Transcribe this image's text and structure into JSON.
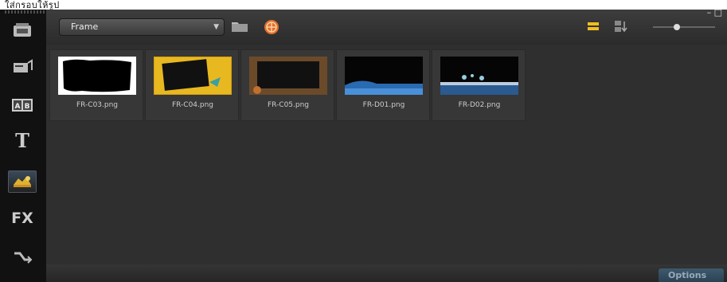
{
  "header": {
    "caption": "ใส่กรอบให้รูป"
  },
  "toolbar": {
    "category": "Frame",
    "dropdown_arrow": "▼",
    "icons": [
      "folder-icon",
      "globe-icon",
      "list-view-icon",
      "sort-icon",
      "zoom-slider"
    ]
  },
  "sidebar": {
    "items": [
      {
        "name": "media-library-icon"
      },
      {
        "name": "instant-project-icon"
      },
      {
        "name": "transition-icon",
        "label": "AB"
      },
      {
        "name": "title-icon",
        "label": "T"
      },
      {
        "name": "graphic-icon",
        "active": true
      },
      {
        "name": "filter-icon",
        "label": "FX"
      },
      {
        "name": "path-icon"
      }
    ]
  },
  "library": {
    "items": [
      {
        "label": "FR-C03.png",
        "thumb": "frame-torn-white"
      },
      {
        "label": "FR-C04.png",
        "thumb": "frame-yellow-tape"
      },
      {
        "label": "FR-C05.png",
        "thumb": "frame-brown-wood"
      },
      {
        "label": "FR-D01.png",
        "thumb": "frame-blue-wave"
      },
      {
        "label": "FR-D02.png",
        "thumb": "frame-blue-splash"
      }
    ]
  },
  "footer": {
    "options_label": "Options"
  },
  "window": {
    "controls": "– □"
  }
}
